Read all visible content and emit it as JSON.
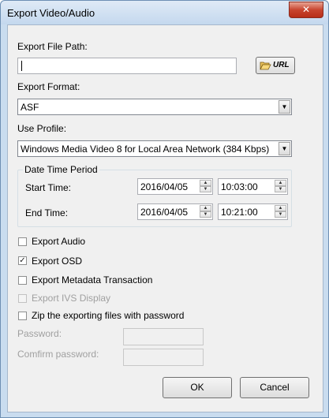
{
  "window": {
    "title": "Export Video/Audio",
    "close_label": "✕"
  },
  "export_path": {
    "label": "Export File Path:",
    "value": "",
    "browse_label": "URL"
  },
  "export_format": {
    "label": "Export Format:",
    "selected": "ASF"
  },
  "use_profile": {
    "label": "Use Profile:",
    "selected": "Windows Media Video 8 for Local Area Network (384 Kbps)"
  },
  "date_time_period": {
    "title": "Date Time Period",
    "start": {
      "label": "Start Time:",
      "date": "2016/04/05",
      "time": "10:03:00"
    },
    "end": {
      "label": "End Time:",
      "date": "2016/04/05",
      "time": "10:21:00"
    }
  },
  "options": {
    "export_audio": {
      "label": "Export Audio",
      "checked": false
    },
    "export_osd": {
      "label": "Export OSD",
      "checked": true
    },
    "export_metadata": {
      "label": "Export Metadata Transaction",
      "checked": false
    },
    "export_ivs": {
      "label": "Export IVS Display",
      "checked": false,
      "enabled": false
    },
    "zip_password": {
      "label": "Zip the exporting files with password",
      "checked": false
    }
  },
  "password": {
    "label": "Password:",
    "confirm_label": "Comfirm password:"
  },
  "buttons": {
    "ok": "OK",
    "cancel": "Cancel"
  }
}
